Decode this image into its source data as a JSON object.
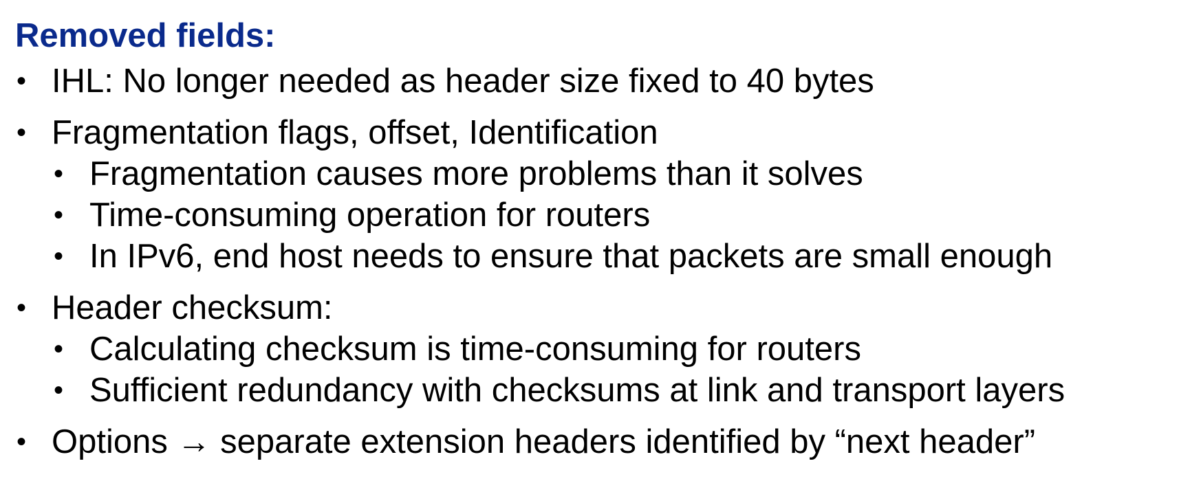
{
  "title": "Removed fields:",
  "bullet_glyph": "•",
  "items": [
    {
      "text": "IHL: No longer needed as header size fixed to 40 bytes"
    },
    {
      "text": "Fragmentation flags, offset, Identification",
      "sub": [
        "Fragmentation causes more problems than it solves",
        "Time-consuming operation for routers",
        "In IPv6, end host needs to ensure that packets are small enough"
      ]
    },
    {
      "text": "Header checksum:",
      "sub": [
        "Calculating checksum is time-consuming for routers",
        "Sufficient redundancy with checksums at link and transport layers"
      ]
    },
    {
      "text": "Options → separate extension headers identified by “next header”"
    }
  ],
  "colors": {
    "title": "#0a2a8c",
    "text": "#000000"
  }
}
